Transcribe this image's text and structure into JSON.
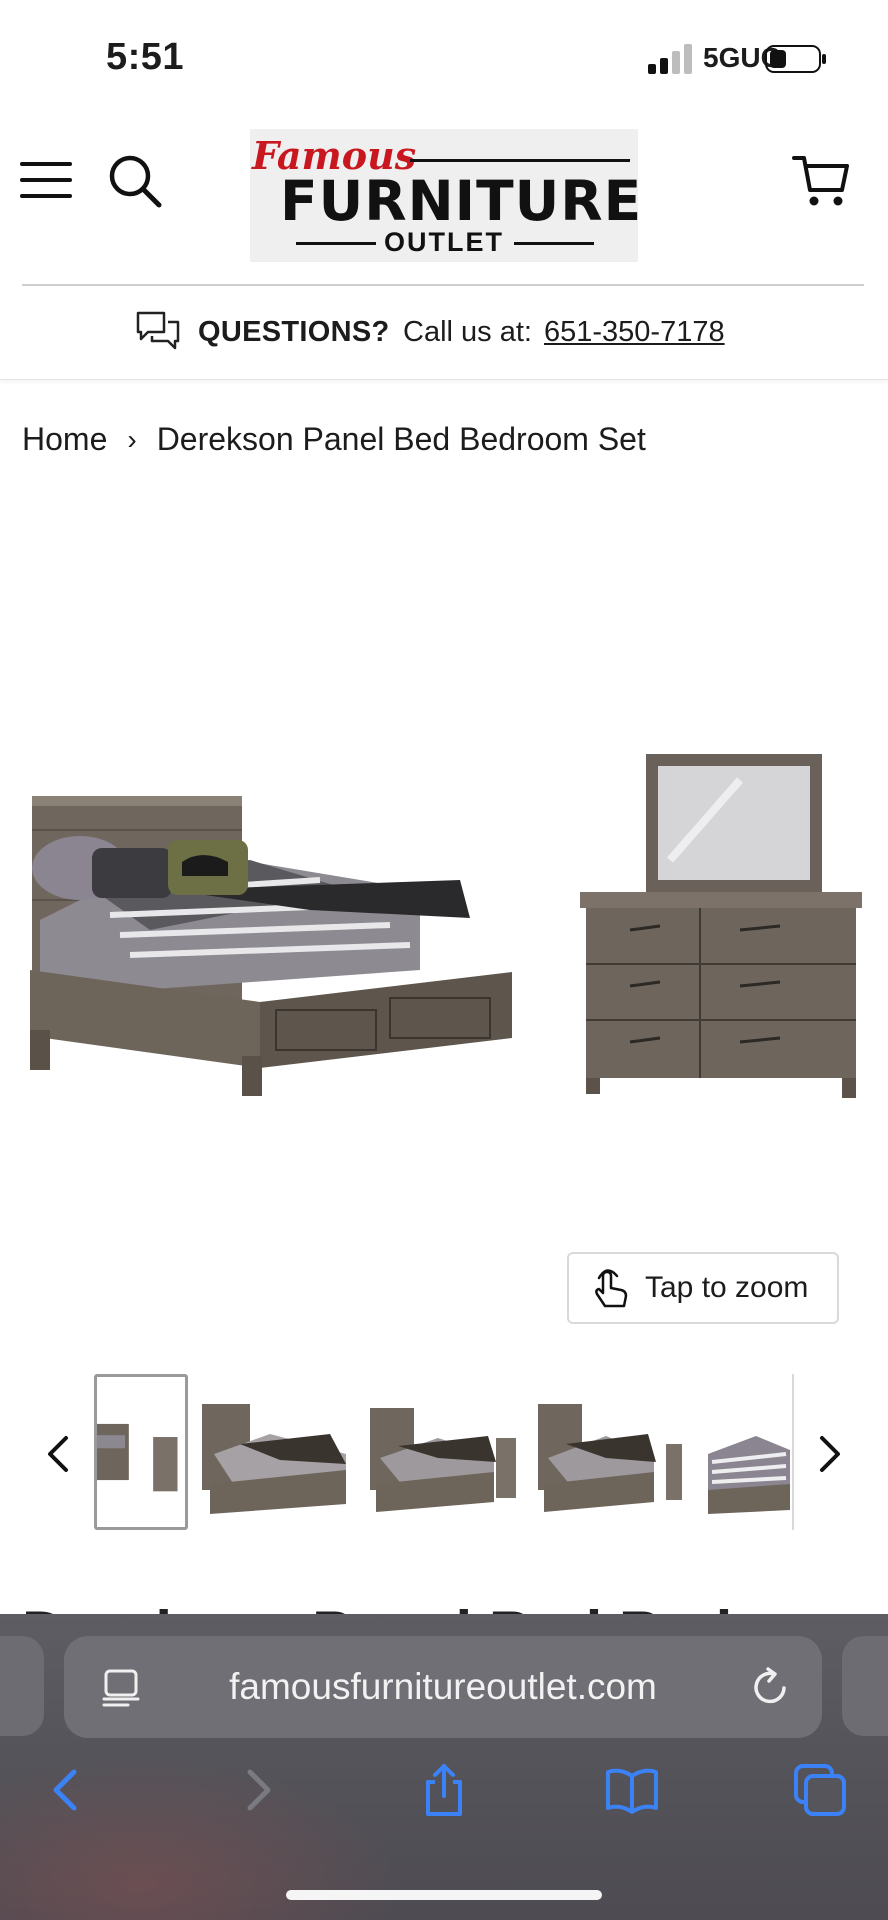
{
  "status_bar": {
    "time": "5:51",
    "network": "5GUC"
  },
  "header": {
    "logo": {
      "script": "Famous",
      "main": "FURNITURE",
      "sub": "OUTLET"
    }
  },
  "questions": {
    "label": "QUESTIONS?",
    "call_text": "Call us at:",
    "phone": "651-350-7178"
  },
  "breadcrumb": {
    "home": "Home",
    "current": "Derekson Panel Bed Bedroom Set"
  },
  "zoom": {
    "label": "Tap to zoom"
  },
  "title_peek": "Derekson Panel Bed Bedroom",
  "browser": {
    "url": "famousfurnitureoutlet.com",
    "accent": "#3b82f6"
  }
}
